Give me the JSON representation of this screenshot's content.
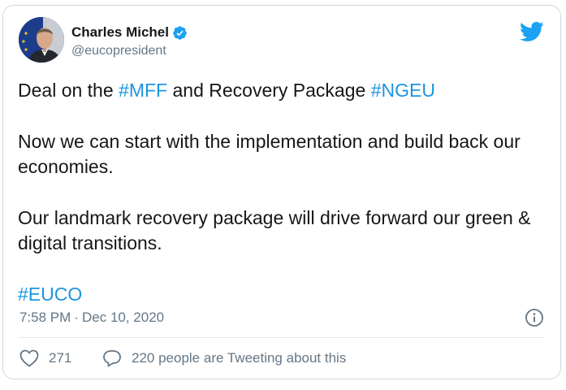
{
  "author": {
    "name": "Charles Michel",
    "handle": "@eucopresident",
    "verified": true
  },
  "tweet": {
    "line1_prefix": "Deal on the ",
    "line1_tag1": "#MFF",
    "line1_middle": " and Recovery Package ",
    "line1_tag2": "#NGEU",
    "paragraph2": "Now we can start with the implementation and build back our economies.",
    "paragraph3": "Our landmark recovery package will drive forward our green & digital transitions.",
    "hashtag_final": "#EUCO"
  },
  "meta": {
    "time": "7:58 PM",
    "separator": "·",
    "date": "Dec 10, 2020"
  },
  "actions": {
    "likes": "271",
    "tweeting": "220 people are Tweeting about this"
  },
  "icons": {
    "logo": "twitter-bird-icon",
    "verified": "verified-badge-icon",
    "info": "info-icon",
    "like": "heart-icon",
    "reply": "speech-bubble-icon"
  },
  "colors": {
    "brand_blue": "#1da1f2",
    "link_blue": "#1b95e0",
    "text_primary": "#14171a",
    "text_secondary": "#657786",
    "border": "#cfd9de"
  }
}
